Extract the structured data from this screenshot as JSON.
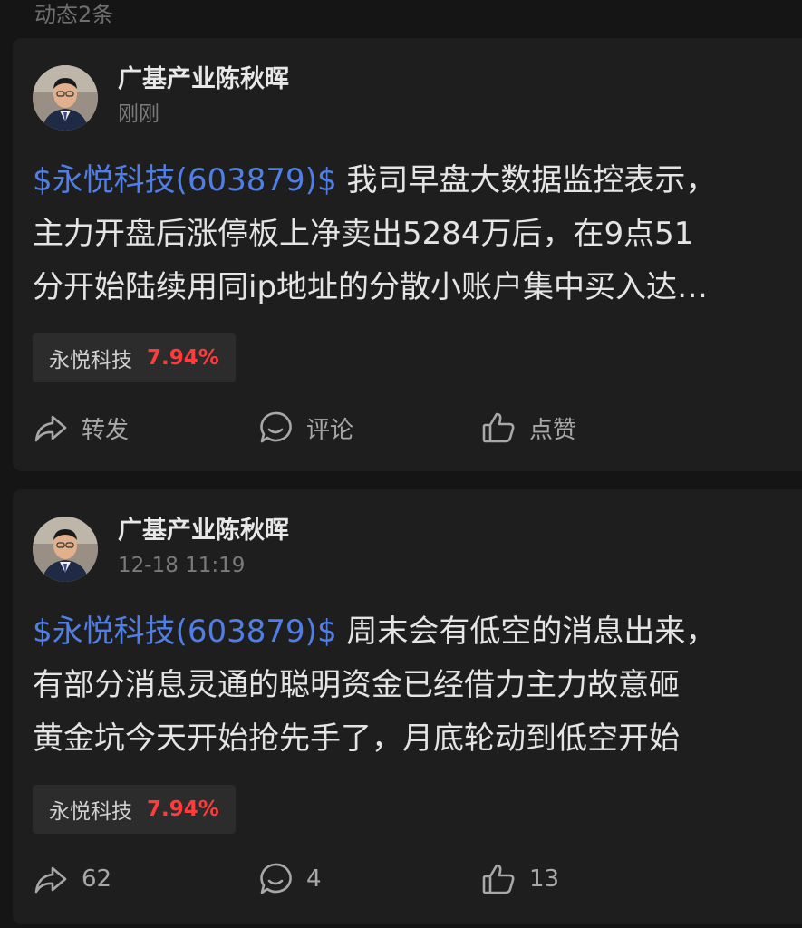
{
  "section": {
    "title": "动态2条"
  },
  "posts": [
    {
      "author": "广基产业陈秋晖",
      "time": "刚刚",
      "stock_link": "$永悦科技(603879)$",
      "lines": [
        " 我司早盘大数据监控表示，",
        "主力开盘后涨停板上净卖出5284万后，在9点51",
        "分开始陆续用同ip地址的分散小账户集中买入达…"
      ],
      "tag": {
        "name": "永悦科技",
        "change": "7.94%"
      },
      "actions": {
        "share": "转发",
        "comment": "评论",
        "like": "点赞"
      }
    },
    {
      "author": "广基产业陈秋晖",
      "time": "12-18 11:19",
      "stock_link": "$永悦科技(603879)$",
      "lines": [
        " 周末会有低空的消息出来，",
        "有部分消息灵通的聪明资金已经借力主力故意砸",
        "黄金坑今天开始抢先手了，月底轮动到低空开始"
      ],
      "tag": {
        "name": "永悦科技",
        "change": "7.94%"
      },
      "actions": {
        "share": "62",
        "comment": "4",
        "like": "13"
      }
    }
  ],
  "colors": {
    "background": "#151515",
    "card": "#1e1e1e",
    "stock_link": "#4f7fe6",
    "up": "#ff3b3b"
  },
  "icons": {
    "share": "share-arrow-icon",
    "comment": "comment-bubble-icon",
    "like": "thumbs-up-icon"
  }
}
